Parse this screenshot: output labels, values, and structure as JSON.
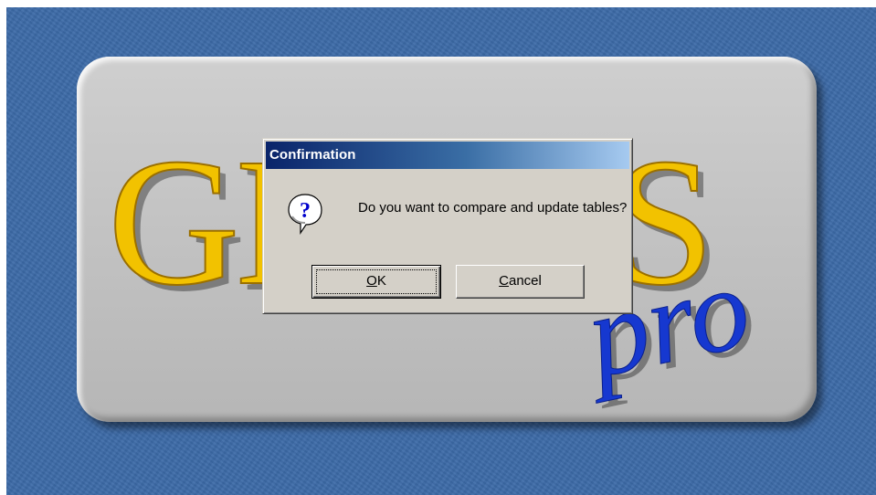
{
  "splash": {
    "logo_text": "GENUS",
    "logo_suffix": "pro"
  },
  "dialog": {
    "title": "Confirmation",
    "icon": "question-icon",
    "message": "Do you want to compare and update tables?",
    "buttons": {
      "ok": {
        "mnemonic": "O",
        "rest": "K"
      },
      "cancel": {
        "mnemonic": "C",
        "rest": "ancel"
      }
    }
  },
  "colors": {
    "desktop": "#3c6aa7",
    "panel": "#c3c3c3",
    "logo_gold": "#f2c200",
    "logo_blue": "#1638d0",
    "titlebar_start": "#0a246a",
    "titlebar_end": "#a6caf0",
    "dialog_face": "#d4d0c8"
  }
}
